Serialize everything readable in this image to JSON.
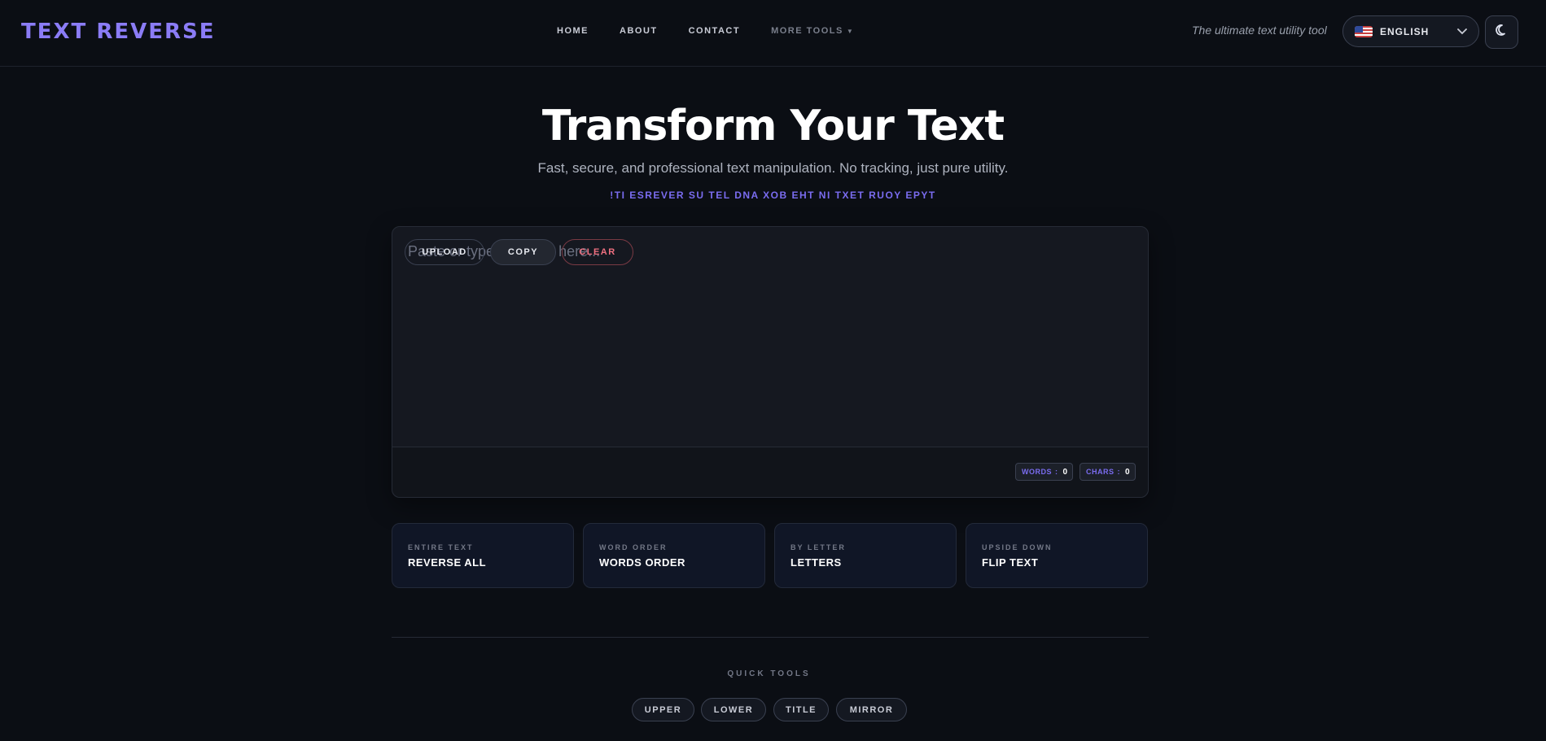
{
  "header": {
    "logo": "TEXT REVERSE",
    "nav": [
      {
        "label": "HOME"
      },
      {
        "label": "ABOUT"
      },
      {
        "label": "CONTACT"
      },
      {
        "label": "MORE TOOLS"
      }
    ],
    "tagline": "The ultimate text utility tool",
    "language": {
      "label": "ENGLISH",
      "flag": "us-flag-icon"
    },
    "theme_icon": "moon-icon"
  },
  "hero": {
    "title": "Transform Your Text",
    "subtitle": "Fast, secure, and professional text manipulation. No tracking, just pure utility.",
    "reversed_tagline": "!TI ESREVER SU TEL DNA XOB EHT NI TXET RUOY EPYT"
  },
  "editor": {
    "placeholder": "Paste or type your text here...",
    "value": "",
    "buttons": {
      "upload": "UPLOAD",
      "copy": "COPY",
      "clear": "CLEAR"
    },
    "counters": {
      "words_label": "WORDS",
      "words_value": "0",
      "chars_label": "CHARS",
      "chars_value": "0",
      "separator": ":"
    }
  },
  "modes": [
    {
      "sub": "ENTIRE TEXT",
      "title": "REVERSE ALL"
    },
    {
      "sub": "WORD ORDER",
      "title": "WORDS ORDER"
    },
    {
      "sub": "BY LETTER",
      "title": "LETTERS"
    },
    {
      "sub": "UPSIDE DOWN",
      "title": "FLIP TEXT"
    }
  ],
  "quick_tools": {
    "label": "QUICK TOOLS",
    "items": [
      "UPPER",
      "LOWER",
      "TITLE",
      "MIRROR"
    ]
  },
  "colors": {
    "accent": "#8b7cf6",
    "background": "#0b0e14",
    "danger": "#f07080"
  }
}
